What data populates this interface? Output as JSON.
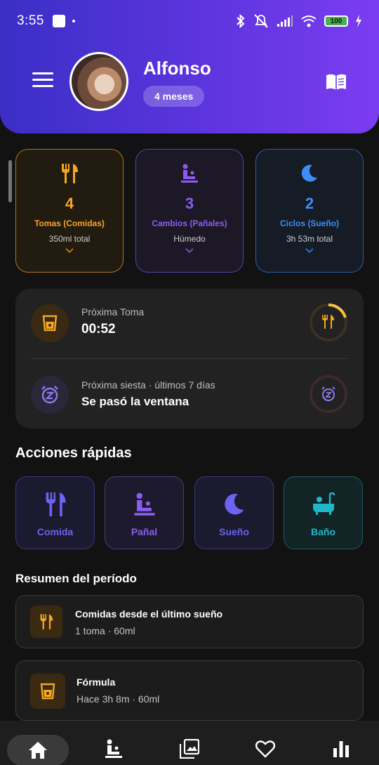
{
  "status": {
    "time": "3:55",
    "battery": "100"
  },
  "header": {
    "name": "Alfonso",
    "age": "4 meses"
  },
  "stats": [
    {
      "value": "4",
      "label": "Tomas (Comidas)",
      "sub": "350ml total",
      "color": "#f5a623"
    },
    {
      "value": "3",
      "label": "Cambios (Pañales)",
      "sub": "Húmedo",
      "color": "#8a5cf0"
    },
    {
      "value": "2",
      "label": "Ciclos (Sueño)",
      "sub": "3h 53m total",
      "color": "#3d8ff5"
    }
  ],
  "next": {
    "feed_label": "Próxima Toma",
    "feed_value": "00:52",
    "nap_label": "Próxima siesta · últimos 7 días",
    "nap_value": "Se pasó la ventana"
  },
  "quick_actions": {
    "title": "Acciones rápidas",
    "items": [
      {
        "label": "Comida",
        "color": "#6b63f2"
      },
      {
        "label": "Pañal",
        "color": "#8a5cf0"
      },
      {
        "label": "Sueño",
        "color": "#6b63f2"
      },
      {
        "label": "Baño",
        "color": "#20b8c8"
      }
    ]
  },
  "summary": {
    "title": "Resumen del período",
    "items": [
      {
        "title": "Comidas desde el último sueño",
        "sub": "1 toma · 60ml"
      },
      {
        "title": "Fórmula",
        "sub": "Hace 3h 8m · 60ml"
      }
    ]
  },
  "colors": {
    "accent": "#5a34dc",
    "feed": "#f5a623",
    "diaper": "#8a5cf0",
    "sleep": "#3d8ff5",
    "bath": "#20b8c8"
  }
}
